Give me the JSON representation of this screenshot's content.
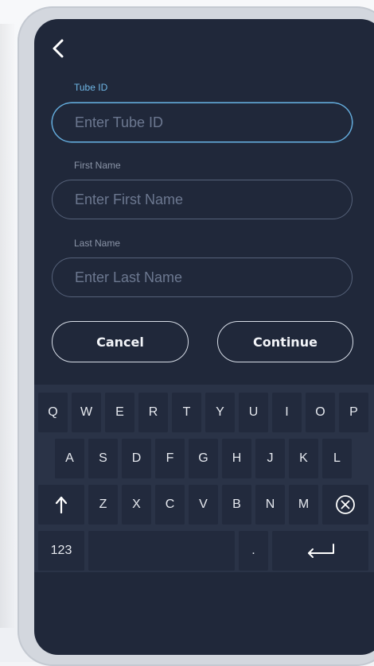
{
  "form": {
    "tube_id": {
      "label": "Tube ID",
      "placeholder": "Enter Tube ID"
    },
    "first_name": {
      "label": "First Name",
      "placeholder": "Enter First Name"
    },
    "last_name": {
      "label": "Last Name",
      "placeholder": "Enter Last Name"
    }
  },
  "actions": {
    "cancel": "Cancel",
    "continue": "Continue"
  },
  "keyboard": {
    "row1": [
      "Q",
      "W",
      "E",
      "R",
      "T",
      "Y",
      "U",
      "I",
      "O",
      "P"
    ],
    "row2": [
      "A",
      "S",
      "D",
      "F",
      "G",
      "H",
      "J",
      "K",
      "L"
    ],
    "row3": [
      "Z",
      "X",
      "C",
      "V",
      "B",
      "N",
      "M"
    ],
    "numbers_key": "123",
    "period_key": "."
  },
  "icons": {
    "back": "chevron-left-icon",
    "shift": "shift-arrow-icon",
    "backspace": "circle-x-icon",
    "return": "return-arrow-icon"
  },
  "colors": {
    "screen_bg": "#20283a",
    "accent": "#6fb7e6",
    "keyboard_bg": "#2a3347"
  }
}
